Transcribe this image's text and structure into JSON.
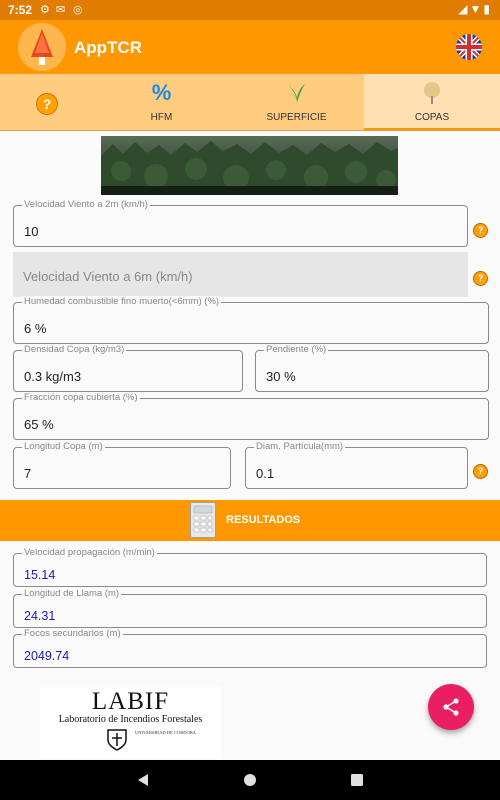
{
  "status_bar": {
    "time": "7:52",
    "icons": [
      "gear-icon",
      "mail-icon",
      "sync-icon",
      "cell-signal-icon",
      "wifi-icon",
      "battery-icon"
    ]
  },
  "app_bar": {
    "title": "AppTCR",
    "logo_icon": "tree-logo-icon",
    "language_icon": "uk-flag-icon"
  },
  "tabs": [
    {
      "id": "help",
      "label": "",
      "icon": "help-icon"
    },
    {
      "id": "hfm",
      "label": "HFM",
      "icon": "percent-icon",
      "icon_text": "%"
    },
    {
      "id": "superficie",
      "label": "SUPERFICIE",
      "icon": "grass-icon"
    },
    {
      "id": "copas",
      "label": "COPAS",
      "icon": "tree-icon",
      "active": true
    }
  ],
  "form": {
    "velocidad_2m": {
      "label": "Velocidad Viento a 2m (km/h)",
      "value": "10"
    },
    "velocidad_6m": {
      "placeholder": "Velocidad Viento a 6m (km/h)"
    },
    "humedad": {
      "label": "Humedad combustible fino muerto(<6mm) (%)",
      "value": "6 %"
    },
    "densidad": {
      "label": "Densidad Copa (kg/m3)",
      "value": "0.3 kg/m3"
    },
    "pendiente": {
      "label": "Pendiente (%)",
      "value": "30 %"
    },
    "fraccion": {
      "label": "Fracción copa cubierta (%)",
      "value": "65 %"
    },
    "longitud_copa": {
      "label": "Longitud Copa (m)",
      "value": "7"
    },
    "diametro": {
      "label": "Diam. Partícula(mm)",
      "value": "0.1"
    }
  },
  "results_header": {
    "label": "RESULTADOS",
    "icon": "calculator-icon"
  },
  "results": {
    "velocidad_propagacion": {
      "label": "Velocidad propagación (m/min)",
      "value": "15.14"
    },
    "longitud_llama": {
      "label": "Longitud de Llama (m)",
      "value": "24.31"
    },
    "focos_secundarios": {
      "label": "Focos secundarios (m)",
      "value": "2049.74"
    }
  },
  "footer_logo": {
    "title": "LABIF",
    "subtitle": "Laboratorio de Incendios Forestales",
    "university": "UNIVERSIDAD DE CORDOBA"
  },
  "colors": {
    "primary": "#ff9800",
    "primary_dark": "#e07c00",
    "tab_bg": "#ffcc80",
    "fab": "#e91e63",
    "result_value": "#1a1ab0"
  }
}
